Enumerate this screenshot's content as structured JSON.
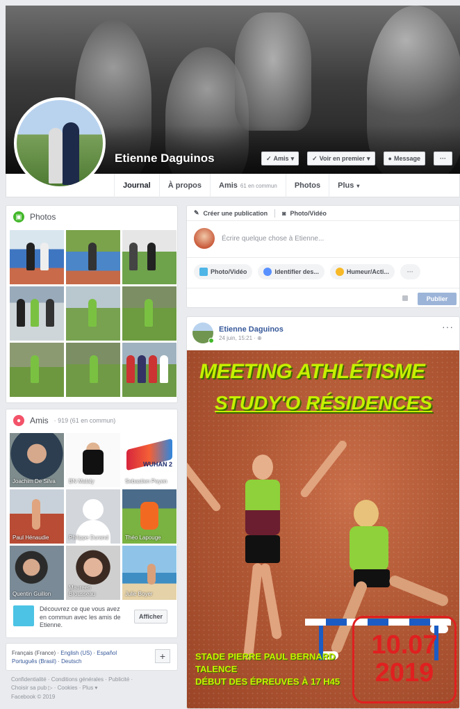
{
  "profile": {
    "name": "Etienne Daguinos",
    "actions": {
      "amis": "Amis",
      "voir_en_premier": "Voir en premier",
      "message": "Message",
      "more": "···"
    }
  },
  "nav": {
    "tabs": [
      {
        "label": "Journal"
      },
      {
        "label": "À propos"
      },
      {
        "label": "Amis",
        "sub": "61 en commun"
      },
      {
        "label": "Photos"
      },
      {
        "label": "Plus"
      }
    ]
  },
  "photos": {
    "title": "Photos"
  },
  "friends": {
    "title": "Amis",
    "count": "· 919 (61 en commun)",
    "items": [
      {
        "name": "Joachim De Silva"
      },
      {
        "name": "BN Malaly"
      },
      {
        "name": "Sebastien Peyen"
      },
      {
        "name": "Paul Hénaudie"
      },
      {
        "name": "Philippe Durand"
      },
      {
        "name": "Théo Lapouge"
      },
      {
        "name": "Quentin Guillon"
      },
      {
        "name": "Maureen Brousseau"
      },
      {
        "name": "Julie Boyer"
      }
    ],
    "discover_text": "Découvrez ce que vous avez en commun avec les amis de Etienne.",
    "discover_button": "Afficher"
  },
  "languages": {
    "current": "Français (France)",
    "links": [
      "English (US)",
      "Español",
      "Português (Brasil)",
      "Deutsch"
    ],
    "separator": " · ",
    "plus": "+"
  },
  "footer": {
    "line1": "Confidentialité · Conditions générales · Publicité ·",
    "line2": "Choisir sa pub ▷ · Cookies · Plus ▾",
    "line3": "Facebook © 2019"
  },
  "composer": {
    "create_post": "Créer une publication",
    "photo_video": "Photo/Vidéo",
    "placeholder": "Écrire quelque chose à Etienne...",
    "options": [
      {
        "label": "Photo/Vidéo",
        "color": "#4eb5e6"
      },
      {
        "label": "Identifier des...",
        "color": "#5890ff"
      },
      {
        "label": "Humeur/Acti...",
        "color": "#f7b928"
      }
    ],
    "more": "···",
    "publish": "Publier"
  },
  "post": {
    "author": "Etienne Daguinos",
    "time": "24 juin, 15:21 · ⊕",
    "dots": "···",
    "poster": {
      "title1": "MEETING ATHLÉTISME",
      "title2": "STUDY'O RÉSIDENCES",
      "venue1": "STADE PIERRE PAUL BERNARD",
      "venue2": "TALENCE",
      "venue3": "DÉBUT DES ÉPREUVES À 17 H45",
      "date1": "10.07",
      "date2": "2019"
    }
  }
}
